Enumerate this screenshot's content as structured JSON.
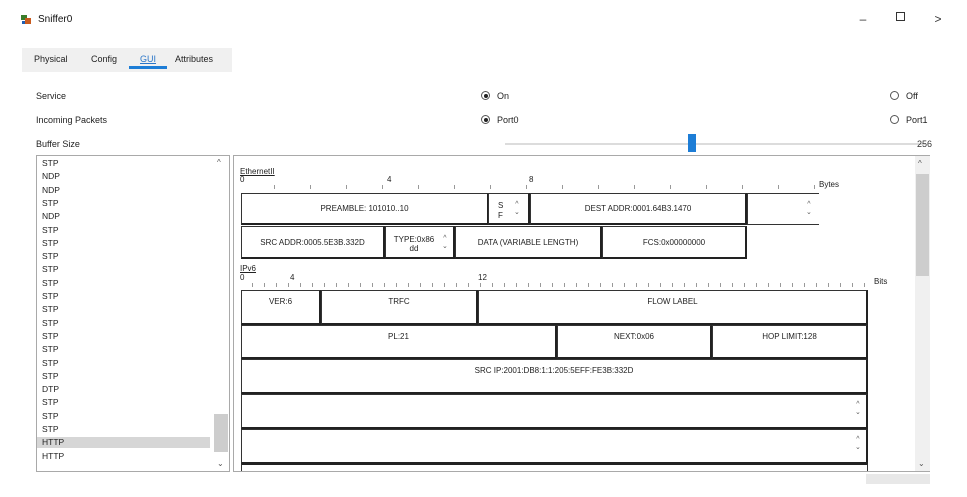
{
  "window": {
    "title": "Sniffer0",
    "minimize": "–",
    "close": ">"
  },
  "tabs": [
    {
      "label": "Physical"
    },
    {
      "label": "Config"
    },
    {
      "label": "GUI"
    },
    {
      "label": "Attributes"
    }
  ],
  "settings": {
    "service": {
      "label": "Service",
      "option_on": "On",
      "option_off": "Off",
      "selected": "On"
    },
    "incoming": {
      "label": "Incoming Packets",
      "option_port0": "Port0",
      "option_port1": "Port1",
      "selected": "Port0"
    },
    "buffer": {
      "label": "Buffer Size",
      "value": "256",
      "slider_fraction": 0.44
    }
  },
  "packet_list": [
    "STP",
    "NDP",
    "NDP",
    "STP",
    "NDP",
    "STP",
    "STP",
    "STP",
    "STP",
    "STP",
    "STP",
    "STP",
    "STP",
    "STP",
    "STP",
    "STP",
    "STP",
    "DTP",
    "STP",
    "STP",
    "STP",
    "HTTP",
    "HTTP"
  ],
  "packet_list_selected_index": 21,
  "ethernet": {
    "label": "EthernetII",
    "ruler": [
      "0",
      "4",
      "8"
    ],
    "unit": "Bytes",
    "preamble": "PREAMBLE: 101010..10",
    "sf_top": "S",
    "sf_bottom": "F",
    "dest": "DEST ADDR:0001.64B3.1470",
    "src": "SRC ADDR:0005.5E3B.332D",
    "type_top": "TYPE:0x86",
    "type_bottom": "dd",
    "data": "DATA (VARIABLE LENGTH)",
    "fcs": "FCS:0x00000000"
  },
  "ipv6": {
    "label": "IPv6",
    "ruler": [
      "0",
      "4",
      "12"
    ],
    "unit": "Bits",
    "ver": "VER:6",
    "trfc": "TRFC",
    "flow": "FLOW LABEL",
    "pl": "PL:21",
    "next": "NEXT:0x06",
    "hop": "HOP LIMIT:128",
    "src": "SRC IP:2001:DB8:1:1:205:5EFF:FE3B:332D"
  },
  "colors": {
    "accent": "#1d7dd6",
    "selected_row": "#d6d6d6"
  }
}
